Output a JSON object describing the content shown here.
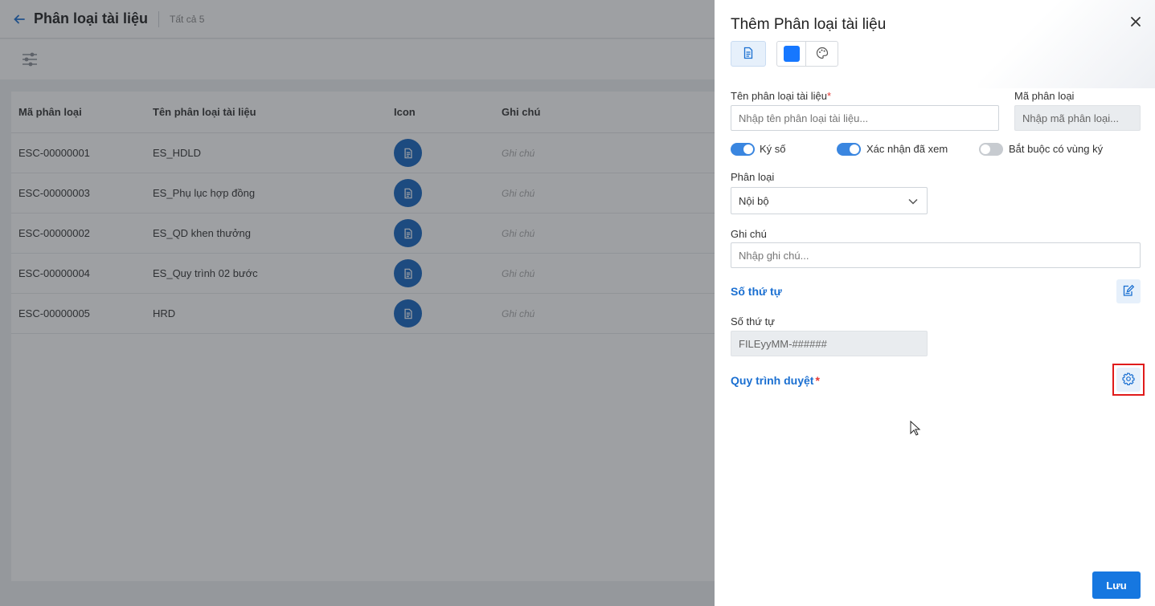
{
  "page": {
    "title": "Phân loại tài liệu",
    "count": "Tất cả 5"
  },
  "table": {
    "headers": [
      "Mã phân loại",
      "Tên phân loại tài liệu",
      "Icon",
      "Ghi chú"
    ],
    "rows": [
      {
        "code": "ESC-00000001",
        "name": "ES_HDLD",
        "note": "Ghi chú"
      },
      {
        "code": "ESC-00000003",
        "name": "ES_Phụ lục hợp đồng",
        "note": "Ghi chú"
      },
      {
        "code": "ESC-00000002",
        "name": "ES_QD khen thưởng",
        "note": "Ghi chú"
      },
      {
        "code": "ESC-00000004",
        "name": "ES_Quy trình 02 bước",
        "note": "Ghi chú"
      },
      {
        "code": "ESC-00000005",
        "name": "HRD",
        "note": "Ghi chú"
      }
    ]
  },
  "drawer": {
    "title": "Thêm Phân loại tài liệu",
    "icon_color": "#1677ff",
    "name_label": "Tên phân loại tài liệu",
    "name_required": "*",
    "name_placeholder": "Nhập tên phân loại tài liệu...",
    "code_label": "Mã phân loại",
    "code_placeholder": "Nhập mã phân loại...",
    "toggles": [
      {
        "label": "Ký số",
        "on": true
      },
      {
        "label": "Xác nhận đã xem",
        "on": true
      },
      {
        "label": "Bắt buộc có vùng ký",
        "on": false
      }
    ],
    "category_label": "Phân loại",
    "category_value": "Nội bộ",
    "note_label": "Ghi chú",
    "note_placeholder": "Nhập ghi chú...",
    "sequence_section": "Số thứ tự",
    "sequence_label": "Số thứ tự",
    "sequence_value": "FILEyyMM-######",
    "workflow_section": "Quy trình duyệt",
    "workflow_required": "*",
    "save_label": "Lưu"
  }
}
